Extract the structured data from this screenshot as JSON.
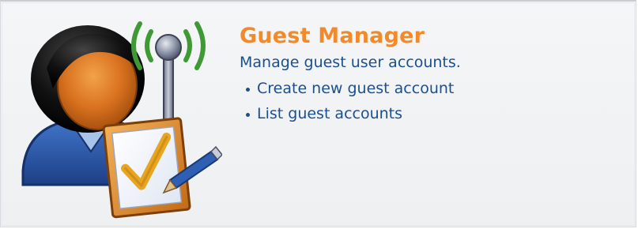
{
  "card": {
    "title": "Guest Manager",
    "subtitle": "Manage guest user accounts.",
    "icon": "guest-manager-icon",
    "links": [
      {
        "label": "Create new guest account"
      },
      {
        "label": "List guest accounts"
      }
    ]
  },
  "colors": {
    "title": "#f08a2b",
    "link": "#1c4f8f",
    "panel_bg": "#f2f3f5",
    "signal": "#4a9a3a"
  }
}
